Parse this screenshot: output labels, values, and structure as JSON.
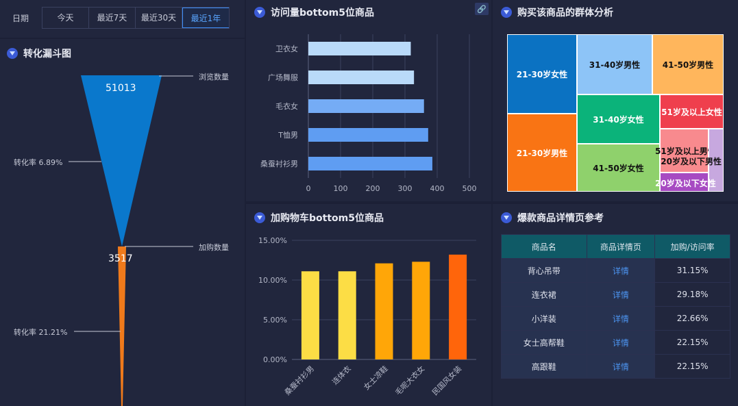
{
  "date_filter": {
    "label": "日期",
    "options": [
      "今天",
      "最近7天",
      "最近30天",
      "最近1年"
    ],
    "selected": "最近1年"
  },
  "funnel": {
    "title": "转化漏斗图",
    "top_value": "51013",
    "top_label": "浏览数量",
    "mid_value": "3517",
    "mid_label": "加购数量",
    "rate1": "转化率 6.89%",
    "rate2": "转化率 21.21%",
    "colors": {
      "top": "#0a78cc",
      "bottom": "#f07a1b"
    }
  },
  "visits": {
    "title": "访问量bottom5位商品",
    "link_icon": "link-icon"
  },
  "cart": {
    "title": "加购物车bottom5位商品"
  },
  "treemap": {
    "title": "购买该商品的群体分析",
    "cells": [
      {
        "label": "21-30岁女性",
        "color": "#0b72c2",
        "text": "#ffffff"
      },
      {
        "label": "31-40岁男性",
        "color": "#8dc4f7",
        "text": "#111111"
      },
      {
        "label": "41-50岁男性",
        "color": "#ffb65c",
        "text": "#111111"
      },
      {
        "label": "21-30岁男性",
        "color": "#f97414",
        "text": "#ffffff"
      },
      {
        "label": "31-40岁女性",
        "color": "#0bb37a",
        "text": "#ffffff"
      },
      {
        "label": "51岁及以上女性",
        "color": "#ef3f4d",
        "text": "#ffffff"
      },
      {
        "label": "41-50岁女性",
        "color": "#8fd16c",
        "text": "#111111"
      },
      {
        "label": "51岁及以上男性",
        "color": "#f88a8e",
        "text": "#111111"
      },
      {
        "label": "20岁及以下男性",
        "color": "#c7a8df",
        "text": "#111111"
      },
      {
        "label": "20岁及以下女性",
        "color": "#a74ac2",
        "text": "#ffffff"
      }
    ]
  },
  "hot_table": {
    "title": "爆款商品详情页参考",
    "headers": [
      "商品名",
      "商品详情页",
      "加购/访问率"
    ],
    "rows": [
      [
        "背心吊带",
        "详情",
        "31.15%"
      ],
      [
        "连衣裙",
        "详情",
        "29.18%"
      ],
      [
        "小洋装",
        "详情",
        "22.66%"
      ],
      [
        "女士高帮鞋",
        "详情",
        "22.15%"
      ],
      [
        "高跟鞋",
        "详情",
        "22.15%"
      ]
    ]
  },
  "chart_data": [
    {
      "type": "bar",
      "orientation": "horizontal",
      "title": "访问量bottom5位商品",
      "categories": [
        "卫衣女",
        "广场舞服",
        "毛衣女",
        "T恤男",
        "桑蚕衬衫男"
      ],
      "values": [
        318,
        328,
        359,
        372,
        385
      ],
      "xlim": [
        0,
        500
      ],
      "xticks": [
        "0",
        "100",
        "200",
        "300",
        "400",
        "500"
      ],
      "colors": [
        "#b9daf9",
        "#b9daf9",
        "#75acf5",
        "#5f9df2",
        "#5f9df2"
      ]
    },
    {
      "type": "bar",
      "title": "加购物车bottom5位商品",
      "categories": [
        "桑蚕衬衫男",
        "连体衣",
        "女士凉鞋",
        "毛呢大衣女",
        "民国风女装"
      ],
      "values": [
        11.1,
        11.1,
        12.1,
        12.3,
        13.2
      ],
      "ylim": [
        0,
        15
      ],
      "yticks": [
        "0.00%",
        "5.00%",
        "10.00%",
        "15.00%"
      ],
      "colors": [
        "#fcdd45",
        "#fcdd45",
        "#ffa608",
        "#ffa608",
        "#ff650b"
      ]
    }
  ]
}
